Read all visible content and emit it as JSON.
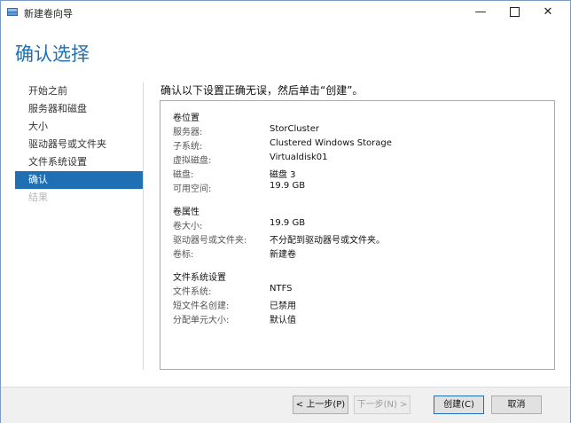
{
  "window": {
    "title": "新建卷向导"
  },
  "page_title": "确认选择",
  "nav": {
    "items": [
      {
        "label": "开始之前",
        "state": "normal"
      },
      {
        "label": "服务器和磁盘",
        "state": "normal"
      },
      {
        "label": "大小",
        "state": "normal"
      },
      {
        "label": "驱动器号或文件夹",
        "state": "normal"
      },
      {
        "label": "文件系统设置",
        "state": "normal"
      },
      {
        "label": "确认",
        "state": "active"
      },
      {
        "label": "结果",
        "state": "disabled"
      }
    ]
  },
  "instruction": "确认以下设置正确无误，然后单击“创建”。",
  "summary": {
    "location": {
      "title": "卷位置",
      "rows": [
        {
          "label": "服务器:",
          "value": "StorCluster"
        },
        {
          "label": "子系统:",
          "value": "Clustered Windows Storage"
        },
        {
          "label": "虚拟磁盘:",
          "value": "Virtualdisk01"
        },
        {
          "label": "磁盘:",
          "value": "磁盘 3"
        },
        {
          "label": "可用空间:",
          "value": "19.9 GB"
        }
      ]
    },
    "properties": {
      "title": "卷属性",
      "rows": [
        {
          "label": "卷大小:",
          "value": "19.9 GB"
        },
        {
          "label": "驱动器号或文件夹:",
          "value": "不分配到驱动器号或文件夹。"
        },
        {
          "label": "卷标:",
          "value": "新建卷"
        }
      ]
    },
    "filesystem": {
      "title": "文件系统设置",
      "rows": [
        {
          "label": "文件系统:",
          "value": "NTFS"
        },
        {
          "label": "短文件名创建:",
          "value": "已禁用"
        },
        {
          "label": "分配单元大小:",
          "value": "默认值"
        }
      ]
    }
  },
  "buttons": {
    "prev": "< 上一步(P)",
    "next": "下一步(N) >",
    "create": "创建(C)",
    "cancel": "取消"
  },
  "colors": {
    "accent": "#1f6fb5"
  }
}
